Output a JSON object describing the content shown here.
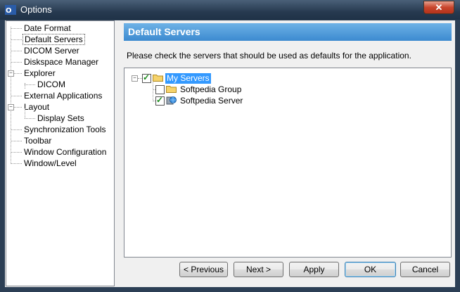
{
  "window": {
    "title": "Options"
  },
  "nav": {
    "items": [
      {
        "label": "Date Format",
        "level": 0
      },
      {
        "label": "Default Servers",
        "level": 0,
        "selected": true
      },
      {
        "label": "DICOM Server",
        "level": 0
      },
      {
        "label": "Diskspace Manager",
        "level": 0
      },
      {
        "label": "Explorer",
        "level": 0,
        "expanded": true
      },
      {
        "label": "DICOM",
        "level": 1
      },
      {
        "label": "External Applications",
        "level": 0
      },
      {
        "label": "Layout",
        "level": 0,
        "expanded": true
      },
      {
        "label": "Display Sets",
        "level": 1
      },
      {
        "label": "Synchronization Tools",
        "level": 0
      },
      {
        "label": "Toolbar",
        "level": 0
      },
      {
        "label": "Window Configuration",
        "level": 0
      },
      {
        "label": "Window/Level",
        "level": 0
      }
    ]
  },
  "panel": {
    "title": "Default Servers",
    "instruction": "Please check the servers that should be used as defaults for the application."
  },
  "servers": {
    "root": {
      "label": "My Servers",
      "checked": true,
      "expanded": true
    },
    "children": [
      {
        "label": "Softpedia Group",
        "checked": false,
        "icon": "folder-icon"
      },
      {
        "label": "Softpedia Server",
        "checked": true,
        "icon": "server-globe-icon"
      }
    ]
  },
  "buttons": {
    "previous": "< Previous",
    "next": "Next >",
    "apply": "Apply",
    "ok": "OK",
    "cancel": "Cancel"
  }
}
